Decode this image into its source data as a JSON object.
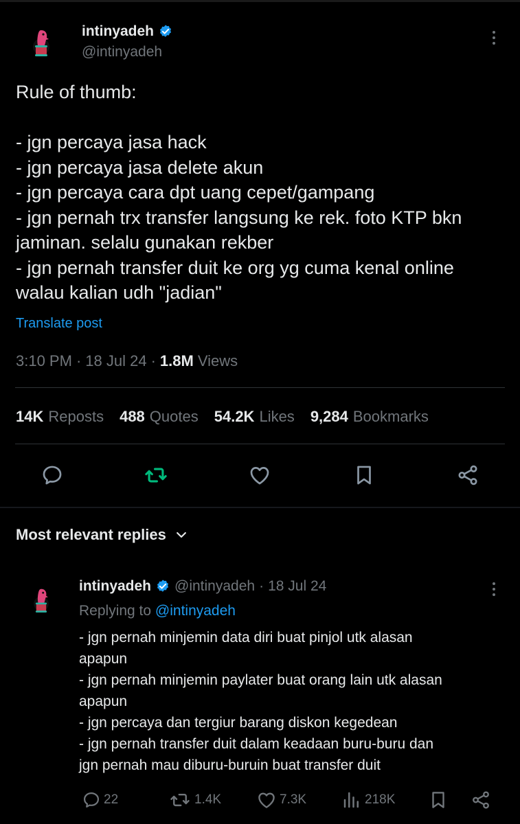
{
  "post": {
    "author_name": "intinyadeh",
    "author_handle": "@intinyadeh",
    "text_lines": [
      "Rule of thumb:",
      "",
      "- jgn percaya jasa hack",
      "- jgn percaya jasa delete akun",
      "- jgn percaya cara dpt uang cepet/gampang",
      "- jgn pernah trx transfer langsung ke rek. foto KTP bkn",
      "jaminan. selalu gunakan rekber",
      "- jgn pernah transfer duit ke org yg cuma kenal online",
      "walau kalian udh \"jadian\""
    ],
    "translate_label": "Translate post",
    "time": "3:10 PM",
    "date": "18 Jul 24",
    "views_count": "1.8M",
    "views_label": "Views",
    "stats": {
      "reposts": {
        "num": "14K",
        "label": "Reposts"
      },
      "quotes": {
        "num": "488",
        "label": "Quotes"
      },
      "likes": {
        "num": "54.2K",
        "label": "Likes"
      },
      "bookmarks": {
        "num": "9,284",
        "label": "Bookmarks"
      }
    },
    "repost_active_color": "#00ba7c"
  },
  "replies_header": "Most relevant replies",
  "reply": {
    "author_name": "intinyadeh",
    "author_handle": "@intinyadeh",
    "separator": "·",
    "date": "18 Jul 24",
    "replying_prefix": "Replying to",
    "replying_to": "@intinyadeh",
    "text_lines": [
      "- jgn pernah minjemin data diri buat pinjol utk alasan",
      "apapun",
      "- jgn pernah minjemin paylater buat orang lain utk alasan",
      "apapun",
      "- jgn percaya dan tergiur barang diskon kegedean",
      "- jgn pernah transfer duit dalam keadaan buru-buru dan",
      "jgn pernah mau diburu-buruin buat transfer duit"
    ],
    "counts": {
      "replies": "22",
      "reposts": "1.4K",
      "likes": "7.3K",
      "views": "218K"
    }
  },
  "icons": [
    "verified-badge-icon",
    "more-icon",
    "reply-icon",
    "repost-icon",
    "like-icon",
    "bookmark-icon",
    "share-icon",
    "views-icon",
    "chevron-down-icon"
  ],
  "colors": {
    "background": "#000000",
    "text": "#e7e9ea",
    "muted": "#71767b",
    "link": "#1d9bf0",
    "verified": "#1d9bf0"
  }
}
